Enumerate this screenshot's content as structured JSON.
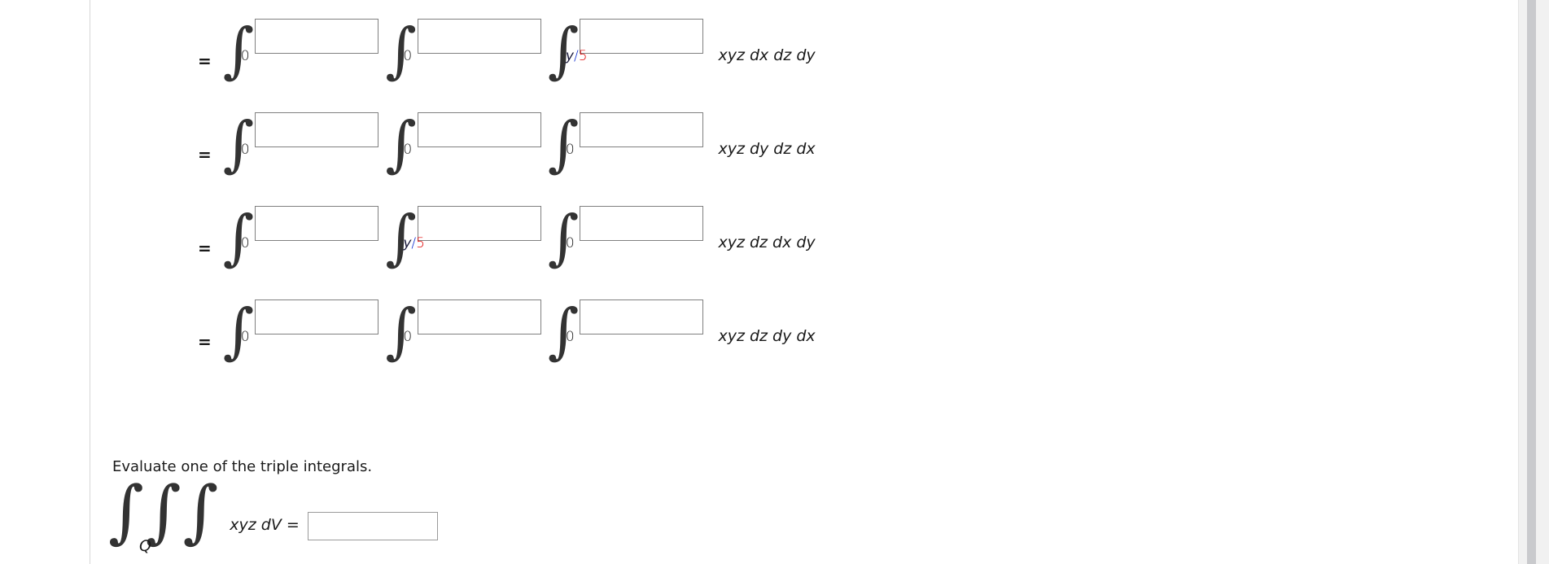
{
  "page": {
    "background_color": "#ffffff",
    "divider_color": "#d6d6d6",
    "box_border_color": "#808080",
    "accent_red": "#e00000",
    "accent_blue": "#1030d0"
  },
  "equations": [
    {
      "equals_label": "=",
      "limits": [
        {
          "parts": [
            {
              "text": "0",
              "style": "zero"
            }
          ]
        },
        {
          "parts": [
            {
              "text": "0",
              "style": "zero"
            }
          ]
        },
        {
          "parts": [
            {
              "text": "y",
              "style": "var"
            },
            {
              "text": "/",
              "style": "slash"
            },
            {
              "text": "5",
              "style": "num"
            }
          ]
        }
      ],
      "integrand_label": "xyz dx dz dy",
      "upper_limit_values": [
        "",
        "",
        ""
      ]
    },
    {
      "equals_label": "=",
      "limits": [
        {
          "parts": [
            {
              "text": "0",
              "style": "zero"
            }
          ]
        },
        {
          "parts": [
            {
              "text": "0",
              "style": "zero"
            }
          ]
        },
        {
          "parts": [
            {
              "text": "0",
              "style": "zero"
            }
          ]
        }
      ],
      "integrand_label": "xyz dy dz dx",
      "upper_limit_values": [
        "",
        "",
        ""
      ]
    },
    {
      "equals_label": "=",
      "limits": [
        {
          "parts": [
            {
              "text": "0",
              "style": "zero"
            }
          ]
        },
        {
          "parts": [
            {
              "text": "y",
              "style": "var"
            },
            {
              "text": "/",
              "style": "slash"
            },
            {
              "text": "5",
              "style": "num"
            }
          ]
        },
        {
          "parts": [
            {
              "text": "0",
              "style": "zero"
            }
          ]
        }
      ],
      "integrand_label": "xyz dz dx dy",
      "upper_limit_values": [
        "",
        "",
        ""
      ]
    },
    {
      "equals_label": "=",
      "limits": [
        {
          "parts": [
            {
              "text": "0",
              "style": "zero"
            }
          ]
        },
        {
          "parts": [
            {
              "text": "0",
              "style": "zero"
            }
          ]
        },
        {
          "parts": [
            {
              "text": "0",
              "style": "zero"
            }
          ]
        }
      ],
      "integrand_label": "xyz dz dy dx",
      "upper_limit_values": [
        "",
        "",
        ""
      ]
    }
  ],
  "prompt": {
    "text": "Evaluate one of the triple integrals."
  },
  "final_integral": {
    "integral_glyph": "∫∫∫",
    "region_subscript": "Q",
    "label": "xyz dV =",
    "answer_value": "",
    "answer_placeholder": ""
  },
  "scrollbar": {
    "track_color": "#f1f1f1",
    "thumb_color": "#c9cacd"
  }
}
